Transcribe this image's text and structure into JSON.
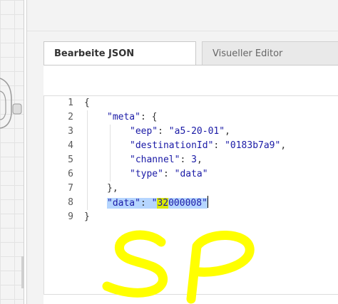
{
  "tabs": {
    "json_label": "Bearbeite JSON",
    "visual_label": "Visueller Editor"
  },
  "editor": {
    "line_numbers": [
      "1",
      "2",
      "3",
      "4",
      "5",
      "6",
      "7",
      "8",
      "9"
    ],
    "lines": {
      "l1": {
        "punc": "{"
      },
      "l2": {
        "key": "\"meta\"",
        "punc": ": {"
      },
      "l3": {
        "key": "\"eep\"",
        "sep": ": ",
        "value": "\"a5-20-01\"",
        "end": ","
      },
      "l4": {
        "key": "\"destinationId\"",
        "sep": ": ",
        "value": "\"0183b7a9\"",
        "end": ","
      },
      "l5": {
        "key": "\"channel\"",
        "sep": ": ",
        "value": "3",
        "end": ","
      },
      "l6": {
        "key": "\"type\"",
        "sep": ": ",
        "value": "\"data\""
      },
      "l7": {
        "punc": "},"
      },
      "l8": {
        "key": "\"data\"",
        "sep": ": ",
        "value_open": "\"",
        "value_match": "32",
        "value_rest": "000008\""
      },
      "l9": {
        "punc": "}"
      }
    },
    "active_line": 8,
    "highlight_color": "#b5d5ff",
    "match_color": "#d9e800",
    "string_color": "#1a1aa6"
  },
  "annotation": {
    "text": "SP",
    "color": "#ffff00"
  }
}
